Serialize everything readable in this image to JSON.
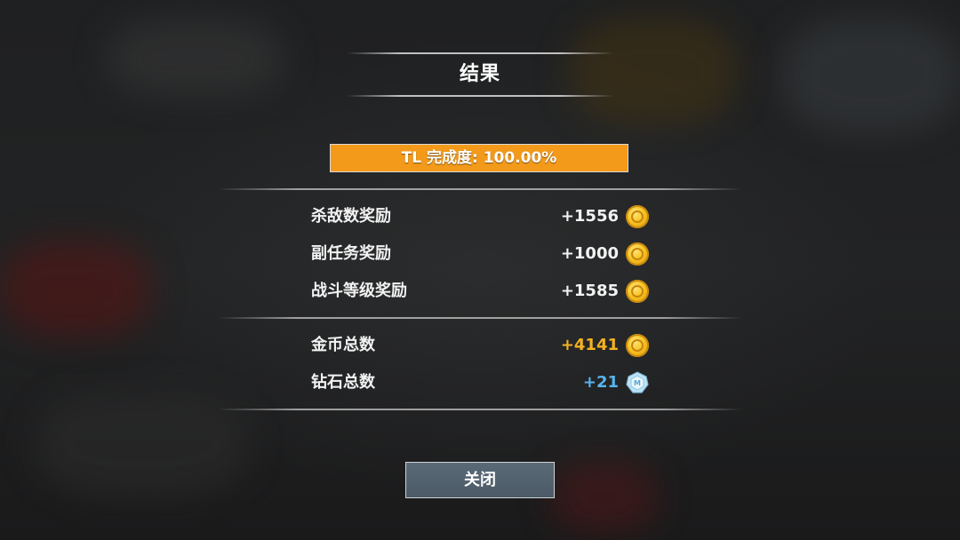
{
  "title": "结果",
  "completion": {
    "label": "TL 完成度: 100.00%",
    "progress": 1.0,
    "fill_color": "#f39a1a"
  },
  "rewards": [
    {
      "label": "杀敌数奖励",
      "value": "+1556",
      "icon": "gold-coin-icon"
    },
    {
      "label": "副任务奖励",
      "value": "+1000",
      "icon": "gold-coin-icon"
    },
    {
      "label": "战斗等级奖励",
      "value": "+1585",
      "icon": "gold-coin-icon"
    }
  ],
  "totals": [
    {
      "label": "金币总数",
      "value": "+4141",
      "icon": "gold-coin-icon",
      "color": "#f4b221"
    },
    {
      "label": "钻石总数",
      "value": "+21",
      "icon": "diamond-icon",
      "color": "#58b4ef"
    }
  ],
  "close_button": {
    "label": "关闭"
  }
}
